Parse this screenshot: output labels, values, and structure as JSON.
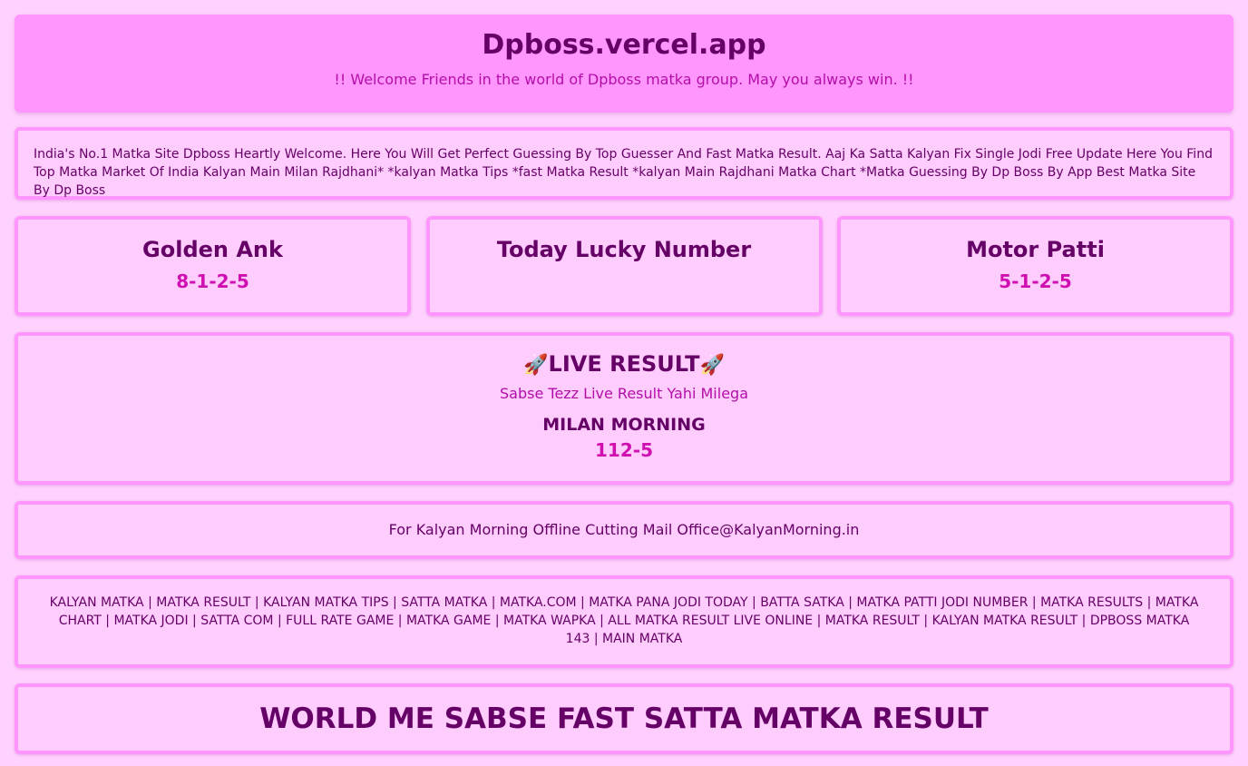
{
  "header": {
    "title": "Dpboss.vercel.app",
    "welcome": "!! Welcome Friends in the world of Dpboss matka group. May you always win. !!"
  },
  "intro": {
    "text": "India's No.1 Matka Site Dpboss Heartly Welcome. Here You Will Get Perfect Guessing By Top Guesser And Fast Matka Result. Aaj Ka Satta Kalyan Fix Single Jodi Free Update Here You Find Top Matka Market Of India Kalyan Main Milan Rajdhani* *kalyan Matka Tips *fast Matka Result *kalyan Main Rajdhani Matka Chart *Matka Guessing By Dp Boss By App Best Matka Site By Dp Boss"
  },
  "cards": [
    {
      "title": "Golden Ank",
      "value": "8-1-2-5"
    },
    {
      "title": "Today Lucky Number",
      "value": ""
    },
    {
      "title": "Motor Patti",
      "value": "5-1-2-5"
    }
  ],
  "live": {
    "rocket_icon": "🚀",
    "title": "LIVE RESULT",
    "subtitle": "Sabse Tezz Live Result Yahi Milega",
    "market_name": "MILAN MORNING",
    "market_result": "112-5"
  },
  "offline": {
    "text": "For Kalyan Morning Offline Cutting Mail Office@KalyanMorning.in"
  },
  "keywords": {
    "text": "KALYAN MATKA | MATKA RESULT | KALYAN MATKA TIPS | SATTA MATKA | MATKA.COM | MATKA PANA JODI TODAY | BATTA SATKA | MATKA PATTI JODI NUMBER | MATKA RESULTS | MATKA CHART | MATKA JODI | SATTA COM | FULL RATE GAME | MATKA GAME | MATKA WAPKA | ALL MATKA RESULT LIVE ONLINE | MATKA RESULT | KALYAN MATKA RESULT | DPBOSS MATKA 143 | MAIN MATKA"
  },
  "banner": {
    "text": "WORLD ME SABSE FAST SATTA MATKA RESULT"
  },
  "colors": {
    "background": "#ffd1fe",
    "header_bg": "#ff96fd",
    "border": "#ff96fd",
    "heading": "#650066",
    "accent": "#cf0fb0"
  }
}
